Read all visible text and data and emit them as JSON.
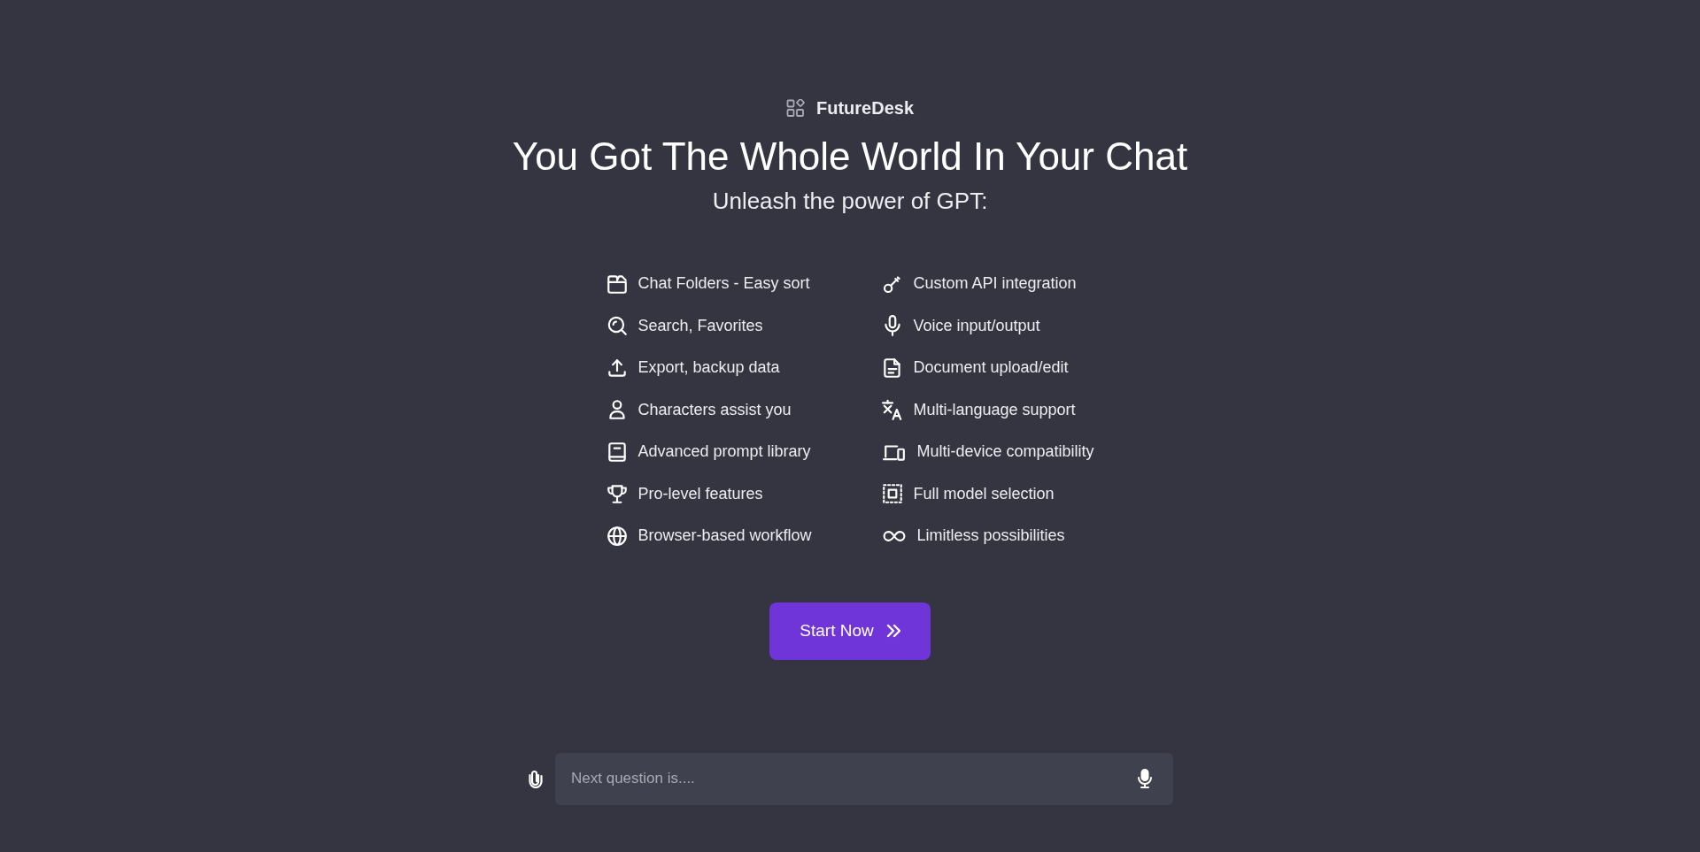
{
  "brand": {
    "name": "FutureDesk"
  },
  "hero": {
    "title": "You Got The Whole World In Your Chat",
    "subtitle": "Unleash the power of GPT:"
  },
  "features": {
    "columns": [
      [
        "Chat Folders - Easy sort",
        "Search, Favorites",
        "Export, backup data",
        "Characters assist you",
        "Advanced prompt library",
        "Pro-level features",
        "Browser-based workflow"
      ],
      [
        "Custom API integration",
        "Voice input/output",
        "Document upload/edit",
        "Multi-language support",
        "Multi-device compatibility",
        "Full model selection",
        "Limitless possibilities"
      ]
    ]
  },
  "start_button": {
    "label": "Start Now"
  },
  "composer": {
    "placeholder": "Next question is...."
  }
}
